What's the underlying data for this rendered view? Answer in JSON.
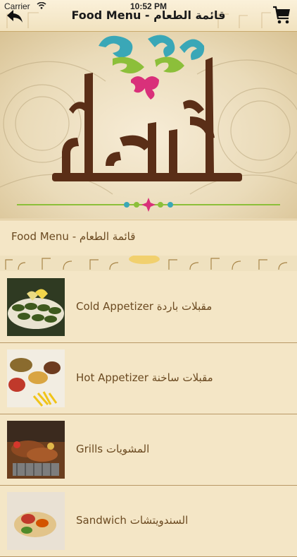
{
  "status": {
    "carrier": "Carrier",
    "time": "10:52 PM"
  },
  "nav": {
    "title": "Food Menu - قائمة الطعام"
  },
  "banner": {
    "logo_text": "أطايب الأعلا"
  },
  "section": {
    "heading": "Food Menu - قائمة الطعام"
  },
  "menu": {
    "items": [
      {
        "label": "Cold Appetizer مقبلات باردة"
      },
      {
        "label": "Hot Appetizer مقبلات ساخنة"
      },
      {
        "label": "Grills المشويات"
      },
      {
        "label": "Sandwich السندويتشات"
      }
    ]
  },
  "colors": {
    "background": "#f4e6c6",
    "text_brown": "#6b4a21",
    "divider": "#b89866"
  },
  "icons": {
    "back": "back-arrow-icon",
    "cart": "shopping-cart-icon",
    "wifi": "wifi-icon"
  }
}
